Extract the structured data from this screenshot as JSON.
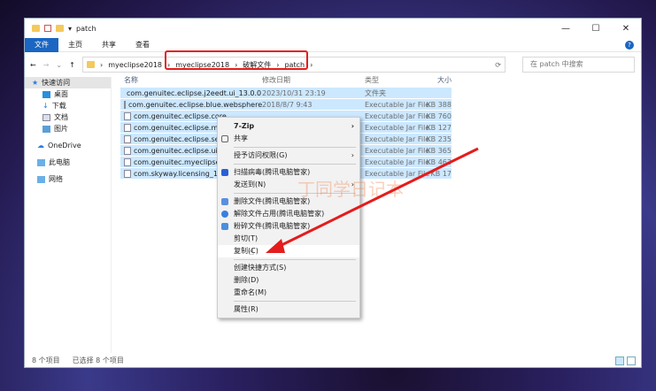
{
  "window": {
    "title": "patch",
    "minimize": "—",
    "maximize": "☐",
    "close": "✕"
  },
  "ribbon": {
    "tabs": [
      "文件",
      "主页",
      "共享",
      "查看"
    ]
  },
  "address": {
    "crumbs": [
      "myeclipse2018",
      "myeclipse2018",
      "破解文件",
      "patch"
    ],
    "search_placeholder": "在 patch 中搜索"
  },
  "sidebar": {
    "items": [
      "快速访问",
      "桌面",
      "下载",
      "文档",
      "图片",
      "OneDrive",
      "此电脑",
      "网络"
    ]
  },
  "columns": {
    "name": "名称",
    "date": "修改日期",
    "type": "类型",
    "size": "大小"
  },
  "files": [
    {
      "name": "com.genuitec.eclipse.j2eedt.ui_13.0.0...",
      "date": "2023/10/31 23:19",
      "type": "文件夹",
      "size": ""
    },
    {
      "name": "com.genuitec.eclipse.blue.websphere...",
      "date": "2018/8/7 9:43",
      "type": "Executable Jar File",
      "size": "388 KB"
    },
    {
      "name": "com.genuitec.eclipse.core",
      "date": "",
      "type": "Executable Jar File",
      "size": "760 KB"
    },
    {
      "name": "com.genuitec.eclipse.mee",
      "date": "",
      "type": "Executable Jar File",
      "size": "127 KB"
    },
    {
      "name": "com.genuitec.eclipse.serv",
      "date": "",
      "type": "Executable Jar File",
      "size": "235 KB"
    },
    {
      "name": "com.genuitec.eclipse.ui.cc",
      "date": "",
      "type": "Executable Jar File",
      "size": "365 KB"
    },
    {
      "name": "com.genuitec.myeclipse.p",
      "date": "",
      "type": "Executable Jar File",
      "size": "463 KB"
    },
    {
      "name": "com.skyway.licensing_13.0",
      "date": "",
      "type": "Executable Jar File",
      "size": "17 KB"
    }
  ],
  "context_menu": {
    "items": [
      "7-Zip",
      "共享",
      "授予访问权限(G)",
      "扫描病毒(腾讯电脑管家)",
      "发送到(N)",
      "删除文件(腾讯电脑管家)",
      "解除文件占用(腾讯电脑管家)",
      "粉碎文件(腾讯电脑管家)",
      "剪切(T)",
      "复制(C)",
      "创建快捷方式(S)",
      "删除(D)",
      "重命名(M)",
      "属性(R)"
    ]
  },
  "status": {
    "count": "8 个项目",
    "selected": "已选择 8 个项目"
  },
  "watermark": "丁同学日记本",
  "colors": {
    "accent": "#1a66c2",
    "selection": "#cce8ff",
    "annotation": "#e51c1c"
  }
}
